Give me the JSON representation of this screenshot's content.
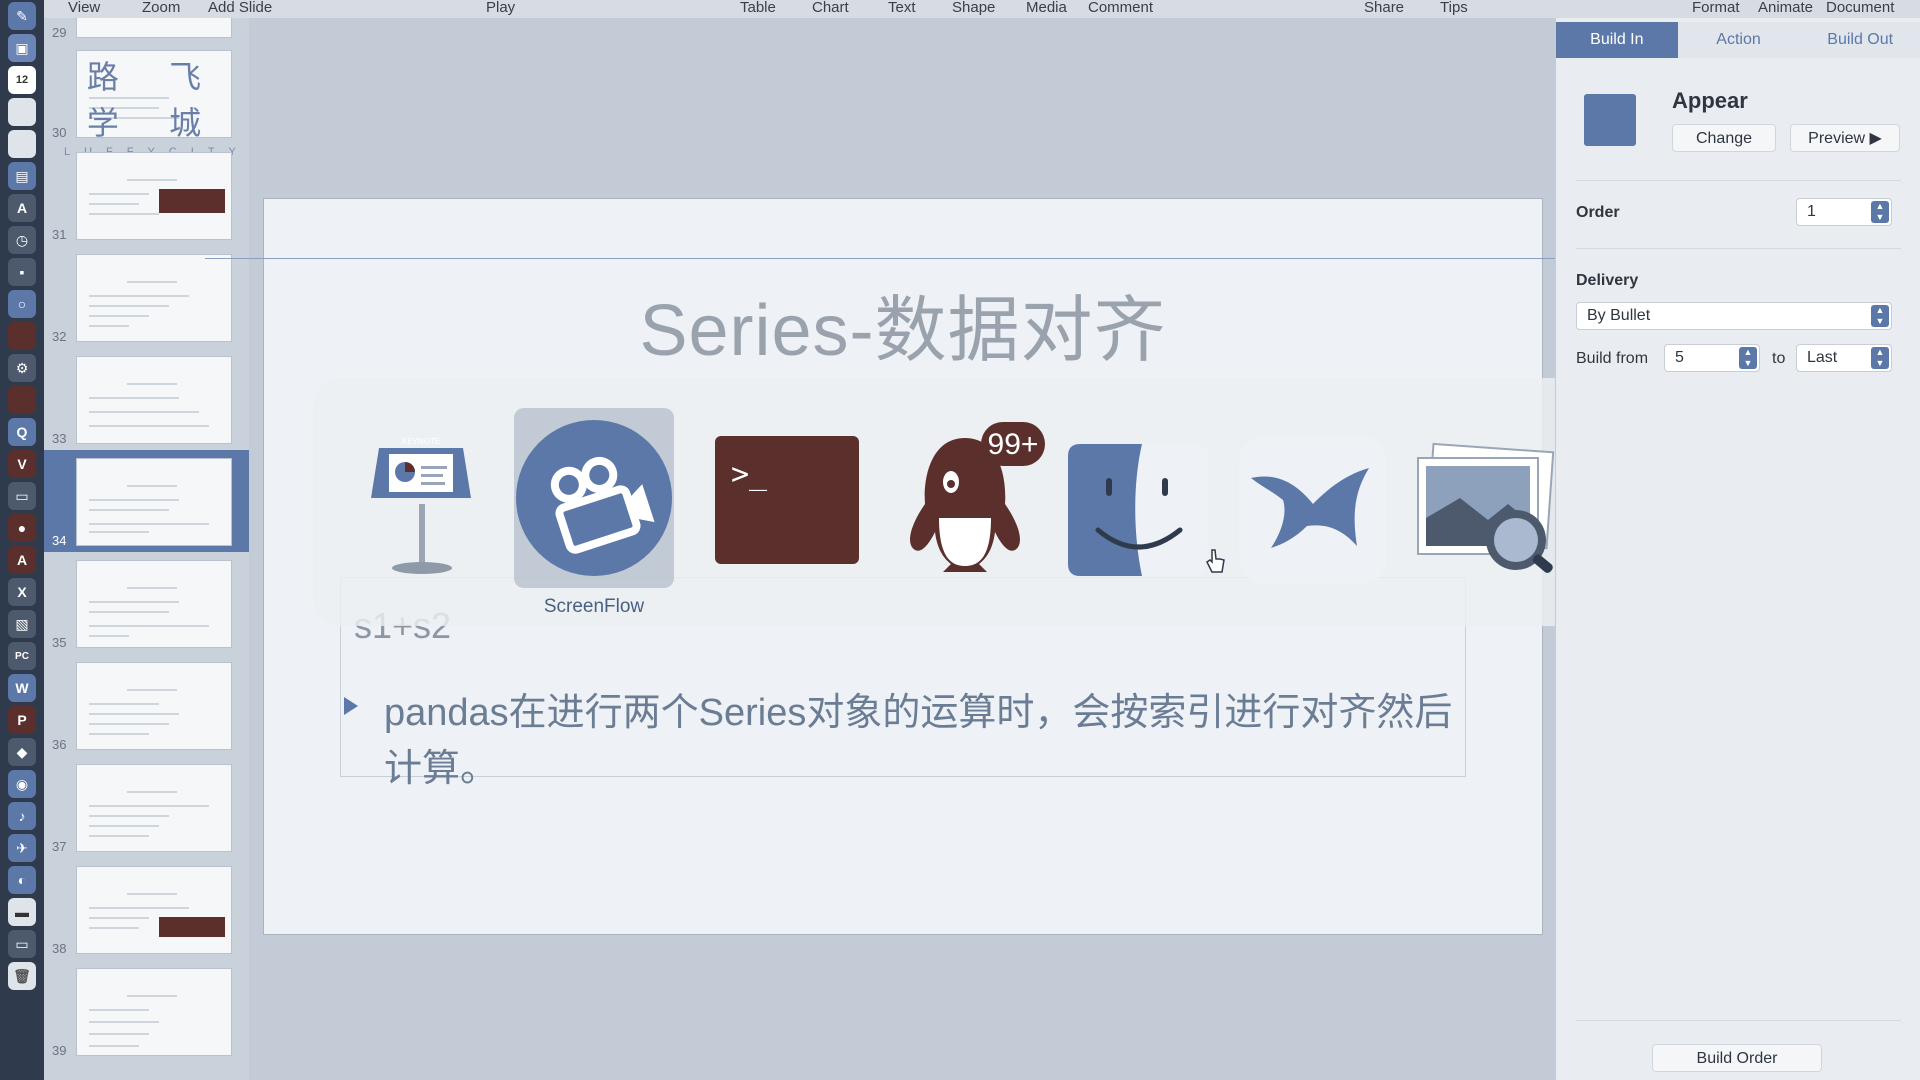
{
  "toolbar": {
    "items": [
      "View",
      "Zoom",
      "Add Slide",
      "Play",
      "Table",
      "Chart",
      "Text",
      "Shape",
      "Media",
      "Comment",
      "Share",
      "Tips",
      "Format",
      "Animate",
      "Document"
    ]
  },
  "navigator": {
    "logo": {
      "chinese": "路 飞 学 城",
      "english": "LUFFYCITY"
    },
    "slides": [
      {
        "number": "29"
      },
      {
        "number": "30"
      },
      {
        "number": "31"
      },
      {
        "number": "32"
      },
      {
        "number": "33"
      },
      {
        "number": "34"
      },
      {
        "number": "35"
      },
      {
        "number": "36"
      },
      {
        "number": "37"
      },
      {
        "number": "38"
      },
      {
        "number": "39"
      }
    ]
  },
  "slide": {
    "title": "Series-数据对齐",
    "partial_bullet": "s1+s2",
    "bullet": "pandas在进行两个Series对象的运算时，会按索引进行对齐然后计算。"
  },
  "app_switcher": {
    "apps": [
      {
        "icon": "keynote-icon"
      },
      {
        "icon": "screenflow-icon",
        "label": "ScreenFlow"
      },
      {
        "icon": "terminal-icon",
        "prompt": ">_"
      },
      {
        "icon": "qq-icon",
        "badge": "99+"
      },
      {
        "icon": "finder-icon"
      },
      {
        "icon": "feishu-bird-icon"
      },
      {
        "icon": "preview-icon"
      }
    ]
  },
  "inspector": {
    "tabs": [
      {
        "label": "Build In",
        "active": true
      },
      {
        "label": "Action",
        "active": false
      },
      {
        "label": "Build Out",
        "active": false
      }
    ],
    "effect_name": "Appear",
    "change_label": "Change",
    "preview_label": "Preview ▶",
    "order_label": "Order",
    "order_value": "1",
    "delivery_label": "Delivery",
    "delivery_value": "By Bullet",
    "build_from_label": "Build from",
    "build_from_value": "5",
    "to_label": "to",
    "to_value": "Last",
    "build_order_label": "Build Order"
  },
  "colors": {
    "accent": "#5b78a8",
    "terminal": "#5a2f2c"
  }
}
